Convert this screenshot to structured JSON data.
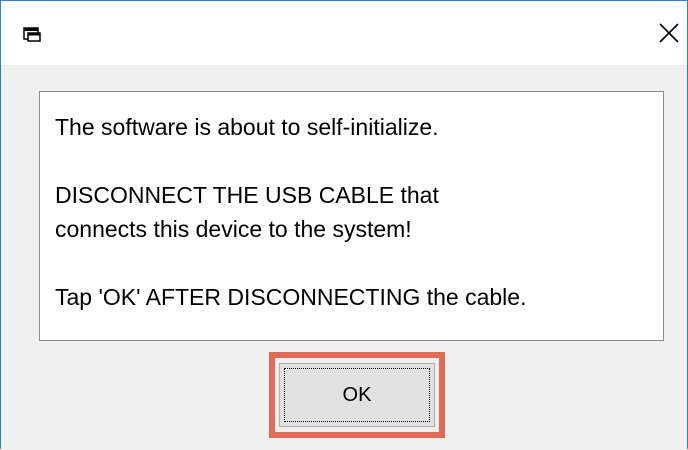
{
  "window": {
    "title": "",
    "app_icon": "dialog-app-icon",
    "close_icon": "close-icon"
  },
  "message": {
    "line1": "The software is about to self-initialize.",
    "line2a": "DISCONNECT THE USB CABLE that",
    "line2b": "connects this device to the system!",
    "line3": "Tap 'OK' AFTER DISCONNECTING the cable."
  },
  "buttons": {
    "ok_label": "OK"
  },
  "colors": {
    "window_border": "#2b7de0",
    "highlight": "#e06c55",
    "dialog_bg": "#f0f0f0"
  }
}
